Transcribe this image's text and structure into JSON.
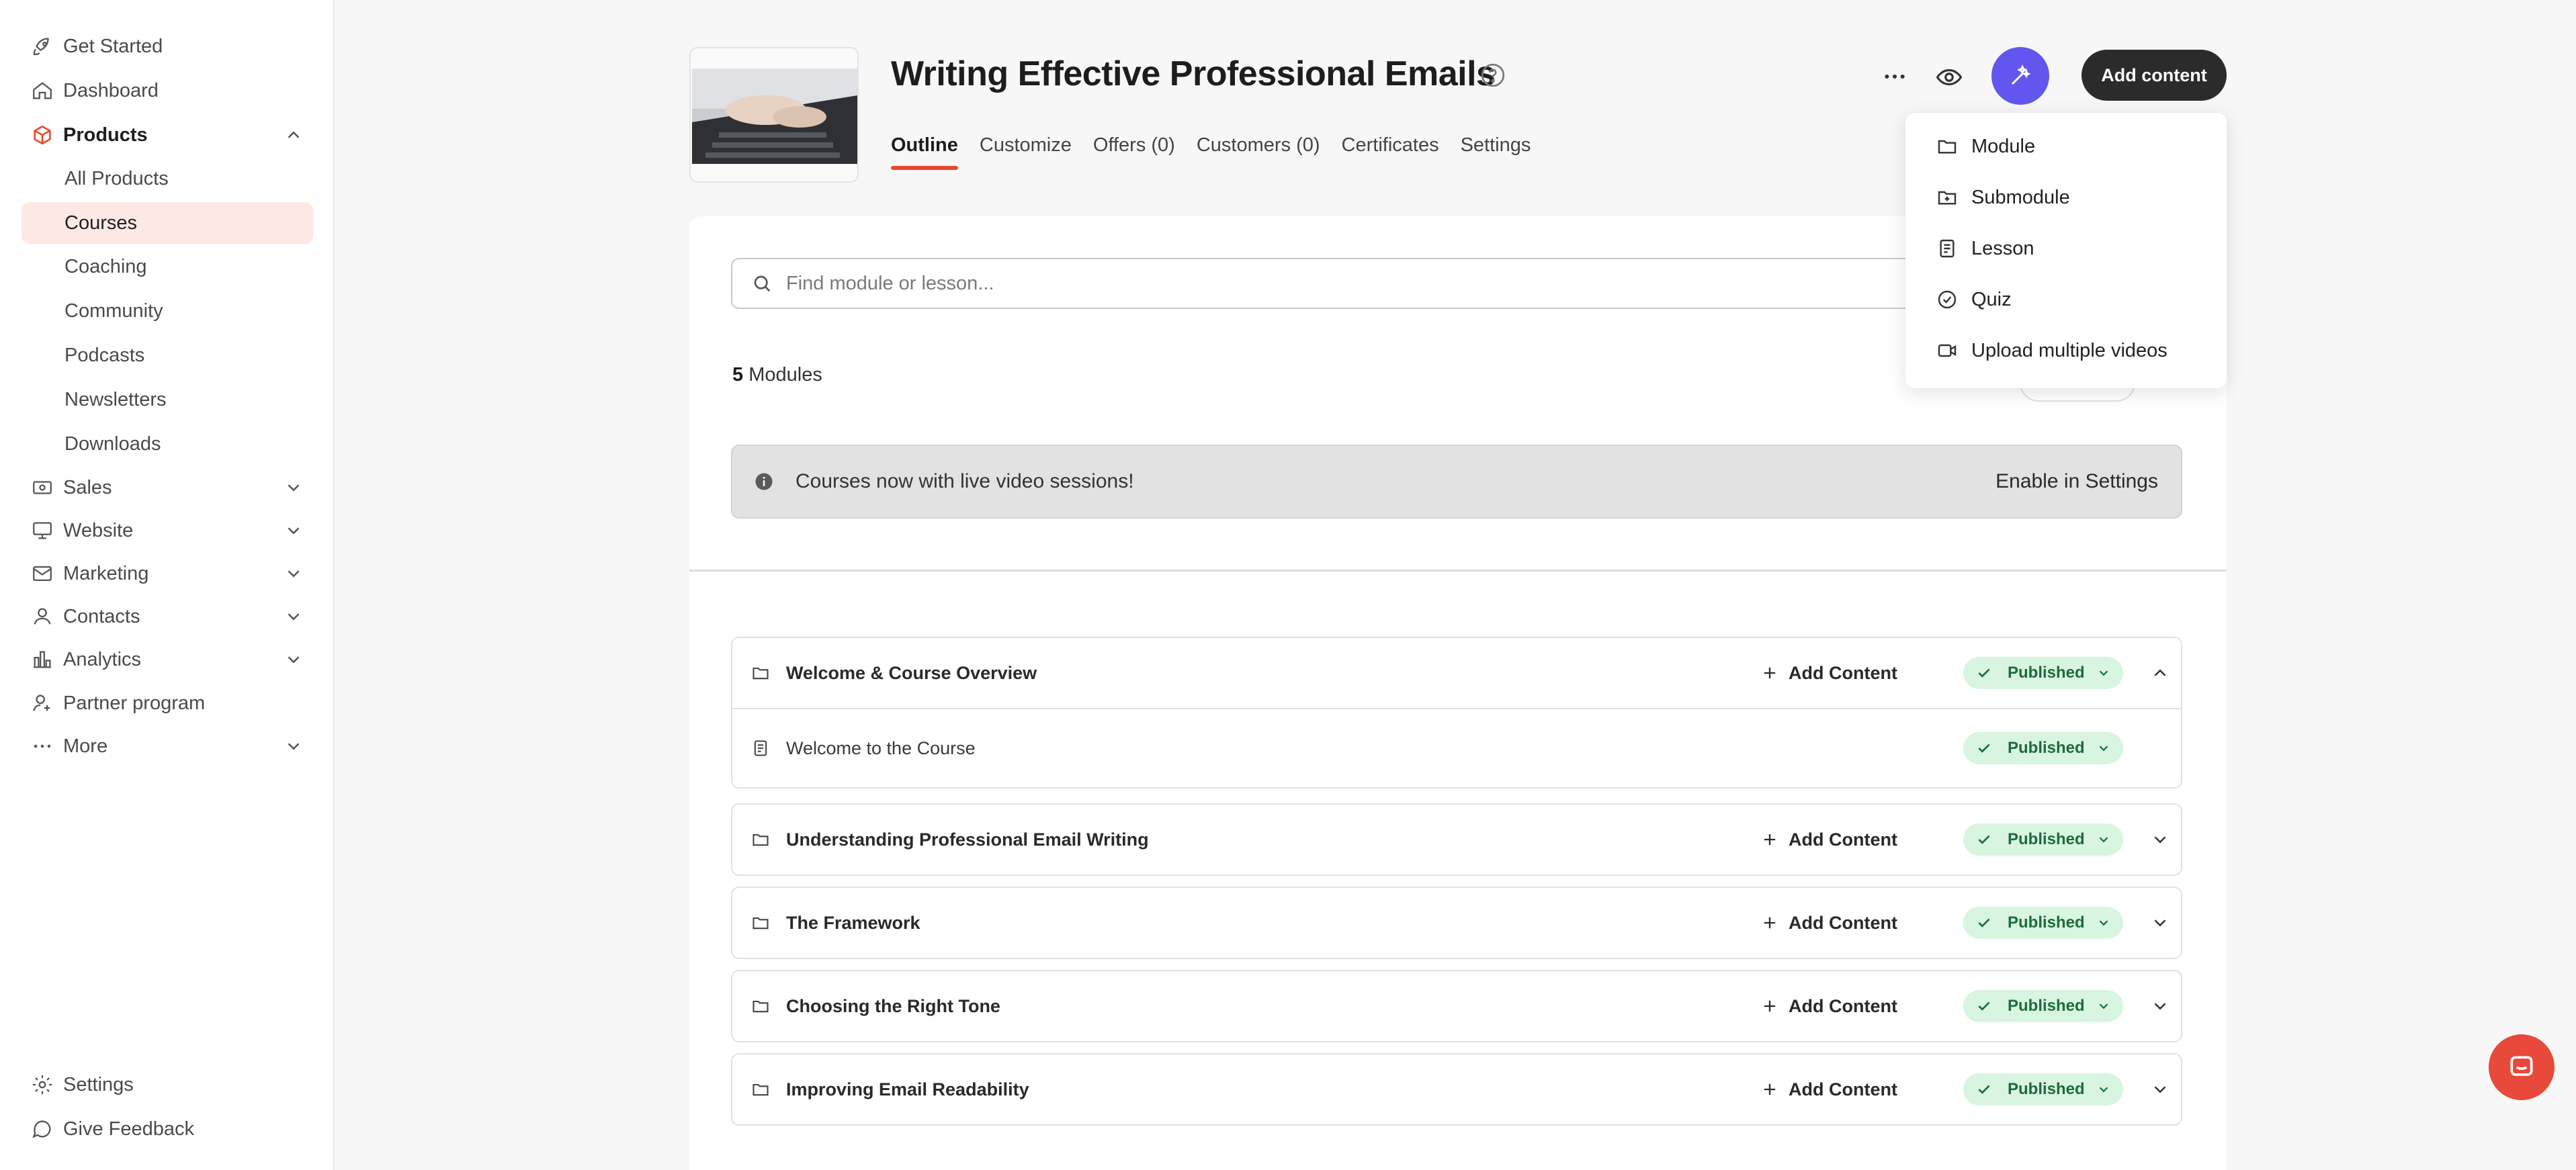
{
  "sidebar": {
    "get_started": "Get Started",
    "dashboard": "Dashboard",
    "products": "Products",
    "all_products": "All Products",
    "courses": "Courses",
    "coaching": "Coaching",
    "community": "Community",
    "podcasts": "Podcasts",
    "newsletters": "Newsletters",
    "downloads": "Downloads",
    "sales": "Sales",
    "website": "Website",
    "marketing": "Marketing",
    "contacts": "Contacts",
    "analytics": "Analytics",
    "partner_program": "Partner program",
    "more": "More",
    "settings": "Settings",
    "give_feedback": "Give Feedback"
  },
  "header": {
    "title": "Writing Effective Professional Emails",
    "add_content_label": "Add content",
    "tabs": [
      "Outline",
      "Customize",
      "Offers (0)",
      "Customers (0)",
      "Certificates",
      "Settings"
    ]
  },
  "search": {
    "placeholder": "Find module or lesson..."
  },
  "modules_summary": {
    "count": "5",
    "label": "Modules"
  },
  "banner": {
    "text": "Courses now with live video sessions!",
    "action": "Enable in Settings"
  },
  "modules": [
    {
      "title": "Welcome & Course Overview",
      "add_label": "Add Content",
      "status": "Published"
    },
    {
      "title": "Welcome to the Course",
      "status": "Published"
    },
    {
      "title": "Understanding Professional Email Writing",
      "add_label": "Add Content",
      "status": "Published"
    },
    {
      "title": "The Framework",
      "add_label": "Add Content",
      "status": "Published"
    },
    {
      "title": "Choosing the Right Tone",
      "add_label": "Add Content",
      "status": "Published"
    },
    {
      "title": "Improving Email Readability",
      "add_label": "Add Content",
      "status": "Published"
    }
  ],
  "dropdown": {
    "items": [
      "Module",
      "Submodule",
      "Lesson",
      "Quiz",
      "Upload multiple videos"
    ]
  },
  "colors": {
    "accent": "#e8492c",
    "magic_button": "#6157ee",
    "published_bg": "#d8f5e0",
    "published_text": "#1f6b3b",
    "active_nav_bg": "#fde8e4"
  },
  "icons": {
    "get_started": "rocket-icon",
    "dashboard": "home-icon",
    "products": "box-icon",
    "sales": "cash-icon",
    "website": "monitor-icon",
    "marketing": "mail-icon",
    "contacts": "user-icon",
    "analytics": "bar-chart-icon",
    "partner": "partner-icon",
    "more": "ellipsis-icon",
    "settings": "gear-icon",
    "feedback": "chat-bubble-icon"
  }
}
